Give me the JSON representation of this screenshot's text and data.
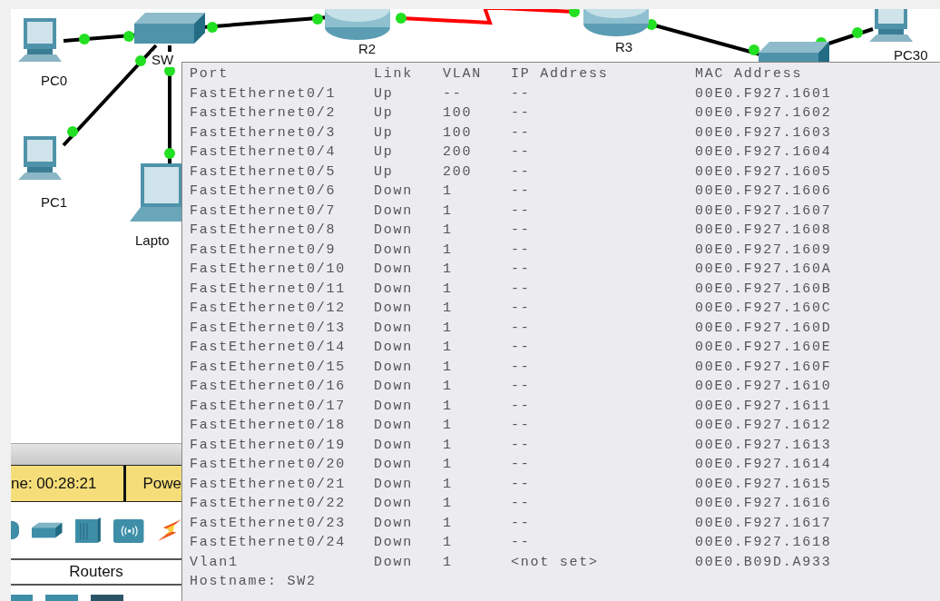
{
  "topology": {
    "nodes": [
      {
        "kind": "pc",
        "label": "PC0"
      },
      {
        "kind": "switch",
        "label": "SW"
      },
      {
        "kind": "router",
        "label": "R2"
      },
      {
        "kind": "router",
        "label": "R3"
      },
      {
        "kind": "switch"
      },
      {
        "kind": "pc",
        "label": "PC30"
      },
      {
        "kind": "pc",
        "label": "PC1"
      },
      {
        "kind": "laptop",
        "label": "Lapto"
      }
    ],
    "links": [
      {
        "color": "#000000"
      },
      {
        "color": "#000000"
      },
      {
        "color": "#ff0000"
      },
      {
        "color": "#000000"
      },
      {
        "color": "#000000"
      },
      {
        "color": "#000000"
      },
      {
        "color": "#000000"
      }
    ]
  },
  "status": {
    "time": "ne: 00:28:21",
    "power": "Powe"
  },
  "device_panel": {
    "category": "Routers"
  },
  "tooltip": {
    "columns": [
      "Port",
      "Link",
      "VLAN",
      "IP Address",
      "MAC Address"
    ],
    "rows": [
      [
        "FastEthernet0/1",
        "Up",
        "--",
        "--",
        "00E0.F927.1601"
      ],
      [
        "FastEthernet0/2",
        "Up",
        "100",
        "--",
        "00E0.F927.1602"
      ],
      [
        "FastEthernet0/3",
        "Up",
        "100",
        "--",
        "00E0.F927.1603"
      ],
      [
        "FastEthernet0/4",
        "Up",
        "200",
        "--",
        "00E0.F927.1604"
      ],
      [
        "FastEthernet0/5",
        "Up",
        "200",
        "--",
        "00E0.F927.1605"
      ],
      [
        "FastEthernet0/6",
        "Down",
        "1",
        "--",
        "00E0.F927.1606"
      ],
      [
        "FastEthernet0/7",
        "Down",
        "1",
        "--",
        "00E0.F927.1607"
      ],
      [
        "FastEthernet0/8",
        "Down",
        "1",
        "--",
        "00E0.F927.1608"
      ],
      [
        "FastEthernet0/9",
        "Down",
        "1",
        "--",
        "00E0.F927.1609"
      ],
      [
        "FastEthernet0/10",
        "Down",
        "1",
        "--",
        "00E0.F927.160A"
      ],
      [
        "FastEthernet0/11",
        "Down",
        "1",
        "--",
        "00E0.F927.160B"
      ],
      [
        "FastEthernet0/12",
        "Down",
        "1",
        "--",
        "00E0.F927.160C"
      ],
      [
        "FastEthernet0/13",
        "Down",
        "1",
        "--",
        "00E0.F927.160D"
      ],
      [
        "FastEthernet0/14",
        "Down",
        "1",
        "--",
        "00E0.F927.160E"
      ],
      [
        "FastEthernet0/15",
        "Down",
        "1",
        "--",
        "00E0.F927.160F"
      ],
      [
        "FastEthernet0/16",
        "Down",
        "1",
        "--",
        "00E0.F927.1610"
      ],
      [
        "FastEthernet0/17",
        "Down",
        "1",
        "--",
        "00E0.F927.1611"
      ],
      [
        "FastEthernet0/18",
        "Down",
        "1",
        "--",
        "00E0.F927.1612"
      ],
      [
        "FastEthernet0/19",
        "Down",
        "1",
        "--",
        "00E0.F927.1613"
      ],
      [
        "FastEthernet0/20",
        "Down",
        "1",
        "--",
        "00E0.F927.1614"
      ],
      [
        "FastEthernet0/21",
        "Down",
        "1",
        "--",
        "00E0.F927.1615"
      ],
      [
        "FastEthernet0/22",
        "Down",
        "1",
        "--",
        "00E0.F927.1616"
      ],
      [
        "FastEthernet0/23",
        "Down",
        "1",
        "--",
        "00E0.F927.1617"
      ],
      [
        "FastEthernet0/24",
        "Down",
        "1",
        "--",
        "00E0.F927.1618"
      ],
      [
        "Vlan1",
        "Down",
        "1",
        "<not set>",
        "00E0.B09D.A933"
      ]
    ],
    "hostname": "Hostname: SW2"
  }
}
